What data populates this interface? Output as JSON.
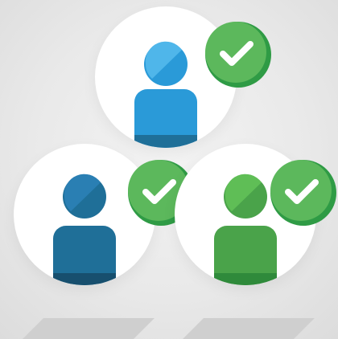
{
  "colors": {
    "background": "#e9e9e9",
    "circle": "#ffffff",
    "user_blue_light": "#4fb6ea",
    "user_blue_mid": "#2a9ad8",
    "user_blue_dark": "#1f6f98",
    "user_green": "#4aa34a",
    "badge_green": "#5cb85c",
    "badge_green_shadow": "#2f9b45",
    "floor_shadow": "#cfcfcf"
  },
  "icons": {
    "user": "user-icon",
    "check": "check-icon"
  }
}
